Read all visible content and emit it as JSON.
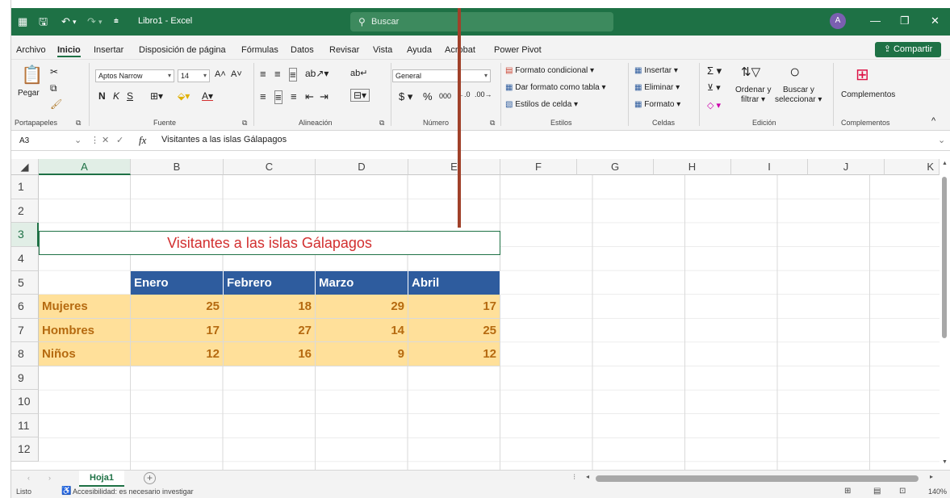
{
  "titlebar": {
    "app_title": "Libro1 - Excel",
    "search_placeholder": "Buscar",
    "avatar_initial": "A"
  },
  "menu": {
    "items": [
      "Archivo",
      "Inicio",
      "Insertar",
      "Disposición de página",
      "Fórmulas",
      "Datos",
      "Revisar",
      "Vista",
      "Ayuda",
      "Acrobat",
      "Power Pivot"
    ],
    "active": "Inicio",
    "share_label": "Compartir"
  },
  "ribbon": {
    "clipboard": {
      "paste": "Pegar",
      "group": "Portapapeles"
    },
    "font": {
      "name": "Aptos Narrow",
      "size": "14",
      "bold": "N",
      "italic": "K",
      "underline": "S",
      "group": "Fuente"
    },
    "alignment": {
      "group": "Alineación"
    },
    "number": {
      "format": "General",
      "currency": "$",
      "percent": "%",
      "thousands": "000",
      "group": "Número"
    },
    "styles": {
      "conditional": "Formato condicional",
      "as_table": "Dar formato como tabla",
      "cell_styles": "Estilos de celda",
      "group": "Estilos"
    },
    "cells": {
      "insert": "Insertar",
      "delete": "Eliminar",
      "format": "Formato",
      "group": "Celdas"
    },
    "editing": {
      "sort_line1": "Ordenar y",
      "sort_line2": "filtrar",
      "find_line1": "Buscar y",
      "find_line2": "seleccionar",
      "group": "Edición"
    },
    "addins": {
      "label": "Complementos",
      "group": "Complementos"
    }
  },
  "formula_bar": {
    "name_box": "A3",
    "fx": "fx",
    "content": "Visitantes a las islas Gálapagos"
  },
  "grid": {
    "columns": [
      "A",
      "B",
      "C",
      "D",
      "E",
      "F",
      "G",
      "H",
      "I",
      "J",
      "K"
    ],
    "rows": [
      "1",
      "2",
      "3",
      "4",
      "5",
      "6",
      "7",
      "8",
      "9",
      "10",
      "11",
      "12"
    ],
    "title": "Visitantes a las islas Gálapagos",
    "headers": [
      "Enero",
      "Febrero",
      "Marzo",
      "Abril"
    ],
    "data": [
      {
        "label": "Mujeres",
        "values": [
          "25",
          "18",
          "29",
          "17"
        ]
      },
      {
        "label": "Hombres",
        "values": [
          "17",
          "27",
          "14",
          "25"
        ]
      },
      {
        "label": "Niños",
        "values": [
          "12",
          "16",
          "9",
          "12"
        ]
      }
    ]
  },
  "sheets": {
    "active": "Hoja1",
    "add": "+"
  },
  "status": {
    "ready": "Listo",
    "accessibility": "Accesibilidad: es necesario investigar",
    "zoom": "140%"
  },
  "colors": {
    "excel_green": "#1e7145",
    "header_blue": "#2e5c9e",
    "data_fill": "#ffe09a",
    "data_text": "#b56a10",
    "title_red": "#d22f2f"
  }
}
